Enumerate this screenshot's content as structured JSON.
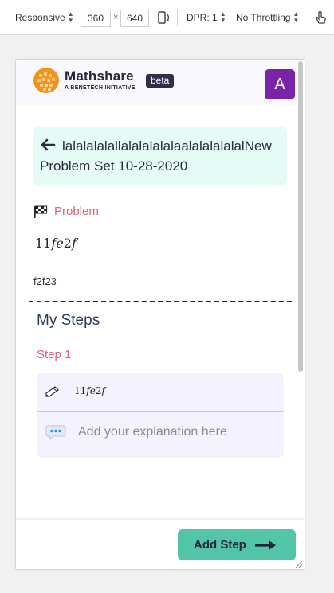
{
  "devtools": {
    "device_mode": "Responsive",
    "width": "360",
    "height": "640",
    "times": "×",
    "dpr": "DPR: 1",
    "throttling": "No Throttling"
  },
  "header": {
    "brand_name": "Mathshare",
    "brand_sub": "A BENETECH INITIATIVE",
    "badge": "beta",
    "avatar_letter": "A"
  },
  "problem_set": {
    "title_line1": "lalalalalallalalalalalaalalalalalalNew",
    "title_line2": "Problem Set 10-28-2020"
  },
  "problem": {
    "label": "Problem",
    "expression_num": "11",
    "expression_var": "fe",
    "expression_num2": "2",
    "expression_var2": "f",
    "text": "f2f23"
  },
  "steps": {
    "heading": "My Steps",
    "step_label": "Step 1",
    "step_expr_num": "11",
    "step_expr_var": "fe",
    "step_expr_num2": "2",
    "step_expr_var2": "f",
    "explanation_placeholder": "Add your explanation here"
  },
  "footer": {
    "add_step_label": "Add Step"
  },
  "colors": {
    "accent_pink": "#e0617a",
    "accent_green": "#52c5a9",
    "title_bg": "#e5fcf6",
    "avatar_bg": "#7b23a8"
  }
}
